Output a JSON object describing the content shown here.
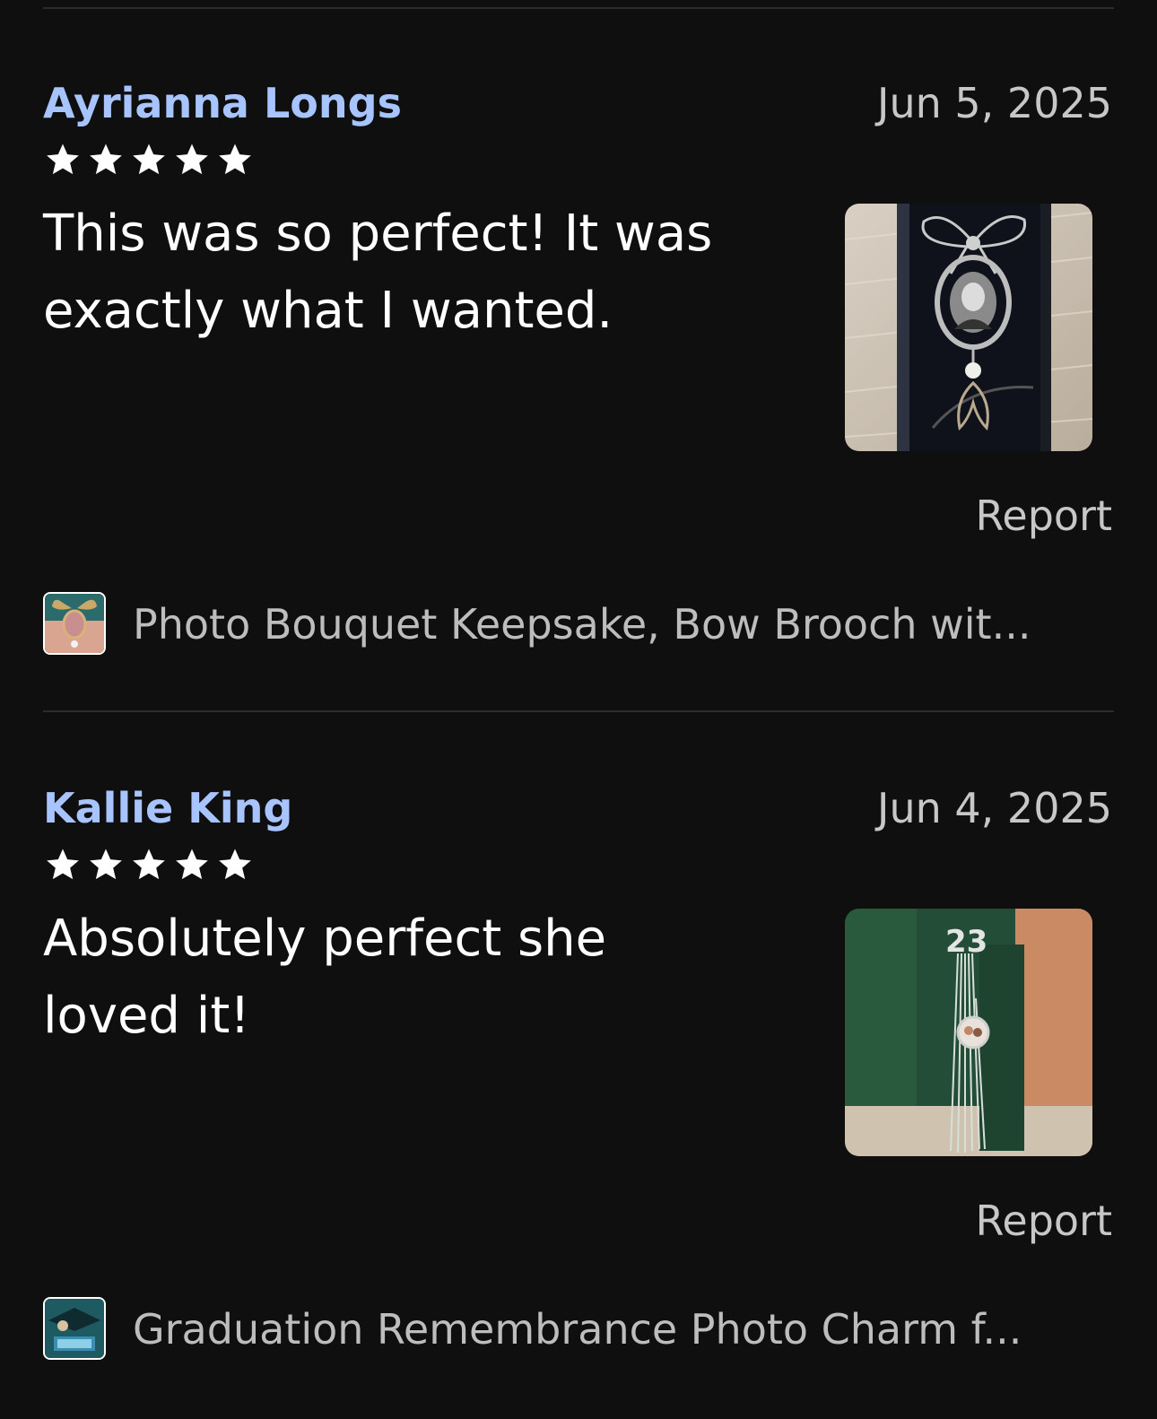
{
  "colors": {
    "background": "#0f0f0f",
    "reviewer_name": "#a8c4ff",
    "secondary_text": "#c7c7c7",
    "divider": "#2c2c2c"
  },
  "reviews": [
    {
      "reviewer": "Ayrianna Longs",
      "date": "Jun 5, 2025",
      "rating": 5,
      "max_rating": 5,
      "text": "This was so perfect! It was exactly what I wanted.",
      "photo_icon": "bow-brooch-photo",
      "report_label": "Report",
      "product": {
        "thumb_icon": "bow-brooch-thumb",
        "title": "Photo Bouquet Keepsake, Bow Brooch wit..."
      }
    },
    {
      "reviewer": "Kallie King",
      "date": "Jun 4, 2025",
      "rating": 5,
      "max_rating": 5,
      "text": "Absolutely perfect she loved it!",
      "photo_icon": "graduation-tassel-photo",
      "report_label": "Report",
      "product": {
        "thumb_icon": "graduation-charm-thumb",
        "title": "Graduation Remembrance Photo Charm f..."
      }
    }
  ]
}
